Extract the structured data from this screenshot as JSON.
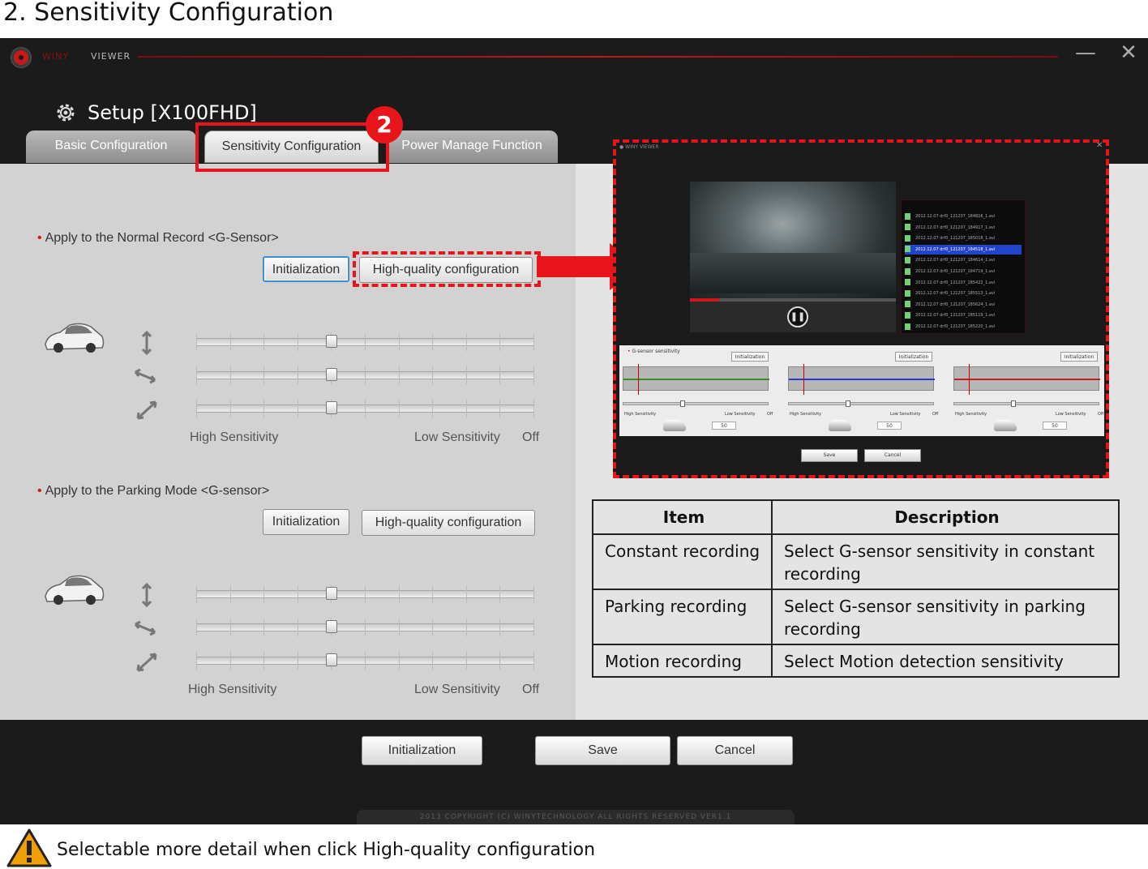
{
  "page": {
    "heading": "2. Sensitivity Configuration",
    "note": "Selectable more detail when click High-quality configuration",
    "step_badge": "2"
  },
  "app": {
    "brand": "WINY",
    "brand_suffix": "VIEWER",
    "setup_title": "Setup [X100FHD]",
    "tabs": [
      {
        "label": "Basic Configuration",
        "selected": false
      },
      {
        "label": "Sensitivity Configuration",
        "selected": true
      },
      {
        "label": "Power Manage Function",
        "selected": false
      }
    ],
    "normal": {
      "label": "Apply to the Normal Record <G-Sensor>",
      "init_label": "Initialization",
      "hq_label": "High-quality configuration",
      "sliders": [
        0.4,
        0.4,
        0.4
      ]
    },
    "parking": {
      "label": "Apply to the Parking Mode <G-sensor>",
      "init_label": "Initialization",
      "hq_label": "High-quality configuration",
      "sliders": [
        0.4,
        0.4,
        0.4
      ]
    },
    "scale": {
      "high": "High Sensitivity",
      "low": "Low Sensitivity",
      "off": "Off"
    },
    "bottom": {
      "init": "Initialization",
      "save": "Save",
      "cancel": "Cancel"
    },
    "copyright": "2013 COPYRIGHT (C) WINYTECHNOLOGY ALL RIGHTS RESERVED VER1.1"
  },
  "inset": {
    "gsensor_label": "G-sensor sensitivity",
    "init": "Initialization",
    "high": "High Sensitivity",
    "low": "Low Sensitivity",
    "off": "Off",
    "value": "50",
    "save": "Save",
    "cancel": "Cancel",
    "file_rows": [
      "2012.12.07  drf0_121207_184816_1.avi",
      "2012.12.07  drf0_121207_184917_1.avi",
      "2012.12.07  drf0_121207_185018_1.avi",
      "2012.12.07  drf0_121207_184518_1.avi",
      "2012.12.07  drf0_121207_184614_1.avi",
      "2012.12.07  drf0_121207_184719_1.avi",
      "2012.12.07  drf0_121207_185422_1.avi",
      "2012.12.07  drf0_121207_185513_1.avi",
      "2012.12.07  drf0_121207_185624_1.avi",
      "2012.12.07  drf0_121207_185119_1.avi",
      "2012.12.07  drf0_121207_185220_1.avi"
    ],
    "selected_row": 3
  },
  "table": {
    "headers": [
      "Item",
      "Description"
    ],
    "rows": [
      [
        "Constant recording",
        "Select G-sensor sensitivity in constant recording"
      ],
      [
        "Parking recording",
        "Select G-sensor sensitivity in parking recording"
      ],
      [
        "Motion recording",
        "Select Motion detection sensitivity"
      ]
    ]
  },
  "colors": {
    "accent_red": "#e8141b",
    "selection_blue": "#3f8fcf"
  }
}
